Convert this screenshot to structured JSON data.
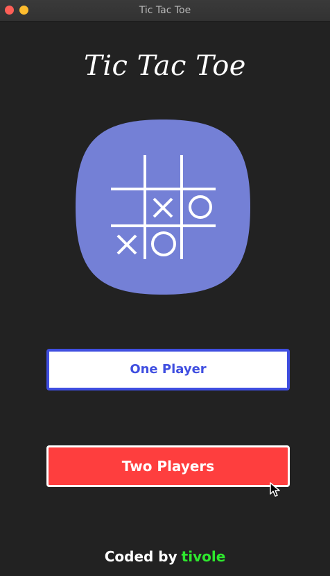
{
  "window": {
    "title": "Tic Tac Toe"
  },
  "app": {
    "title": "Tic Tac Toe"
  },
  "logo": {
    "icon": "tic-tac-toe-board-icon",
    "background_color": "#7480d6"
  },
  "buttons": {
    "one_player_label": "One Player",
    "two_players_label": "Two Players"
  },
  "footer": {
    "prefix": "Coded by",
    "author": "tivole"
  },
  "colors": {
    "background": "#222222",
    "one_player_accent": "#3f4ee0",
    "two_players_bg": "#fe3e3e",
    "author": "#2ee82e"
  }
}
